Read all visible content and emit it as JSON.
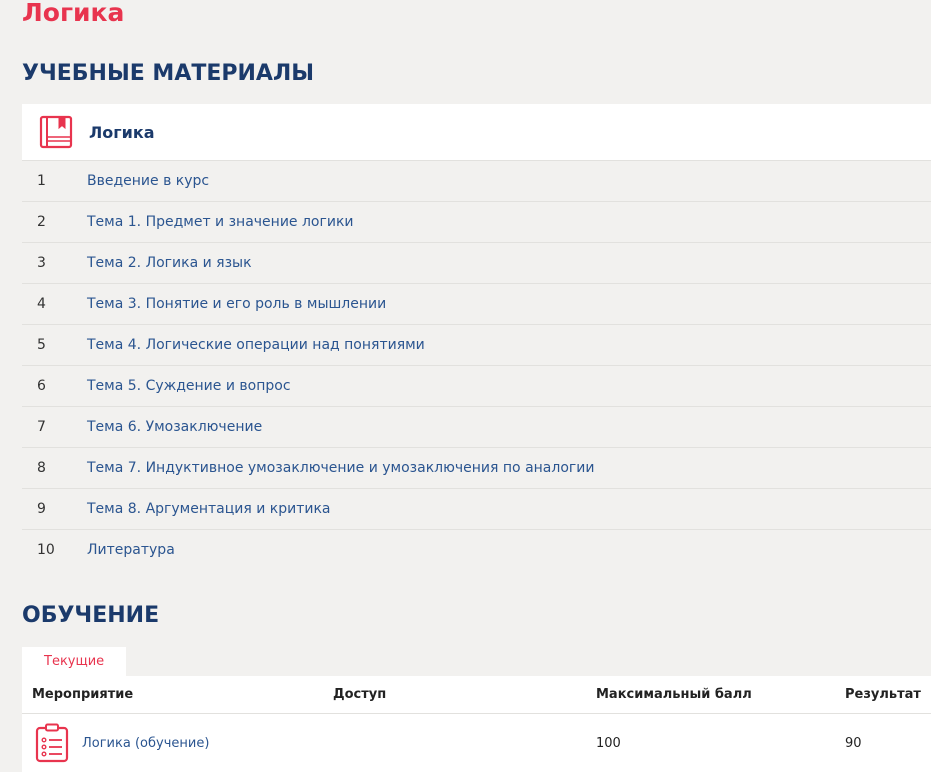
{
  "page": {
    "title": "Логика"
  },
  "materials": {
    "heading": "УЧЕБНЫЕ МАТЕРИАЛЫ",
    "course": {
      "name": "Логика",
      "icon": "book-icon",
      "lessons": [
        {
          "num": "1",
          "title": "Введение в курс"
        },
        {
          "num": "2",
          "title": "Тема 1. Предмет и значение логики"
        },
        {
          "num": "3",
          "title": "Тема 2. Логика и язык"
        },
        {
          "num": "4",
          "title": "Тема 3. Понятие и его роль в мышлении"
        },
        {
          "num": "5",
          "title": "Тема 4. Логические операции над понятиями"
        },
        {
          "num": "6",
          "title": "Тема 5. Суждение и вопрос"
        },
        {
          "num": "7",
          "title": "Тема 6. Умозаключение"
        },
        {
          "num": "8",
          "title": "Тема 7. Индуктивное умозаключение и умозаключения по аналогии"
        },
        {
          "num": "9",
          "title": "Тема 8. Аргументация и критика"
        },
        {
          "num": "10",
          "title": "Литература"
        }
      ]
    }
  },
  "training": {
    "heading": "ОБУЧЕНИЕ",
    "tabs": [
      {
        "label": "Текущие",
        "active": true
      }
    ],
    "table": {
      "columns": [
        "Мероприятие",
        "Доступ",
        "Максимальный балл",
        "Результат"
      ],
      "rows": [
        {
          "icon": "clipboard-list-icon",
          "event": "Логика (обучение)",
          "access": "",
          "max_score": "100",
          "result": "90"
        }
      ]
    }
  },
  "colors": {
    "accent": "#e8344e",
    "heading": "#1b3a6b",
    "link": "#2b5590",
    "background": "#f2f1ef"
  }
}
